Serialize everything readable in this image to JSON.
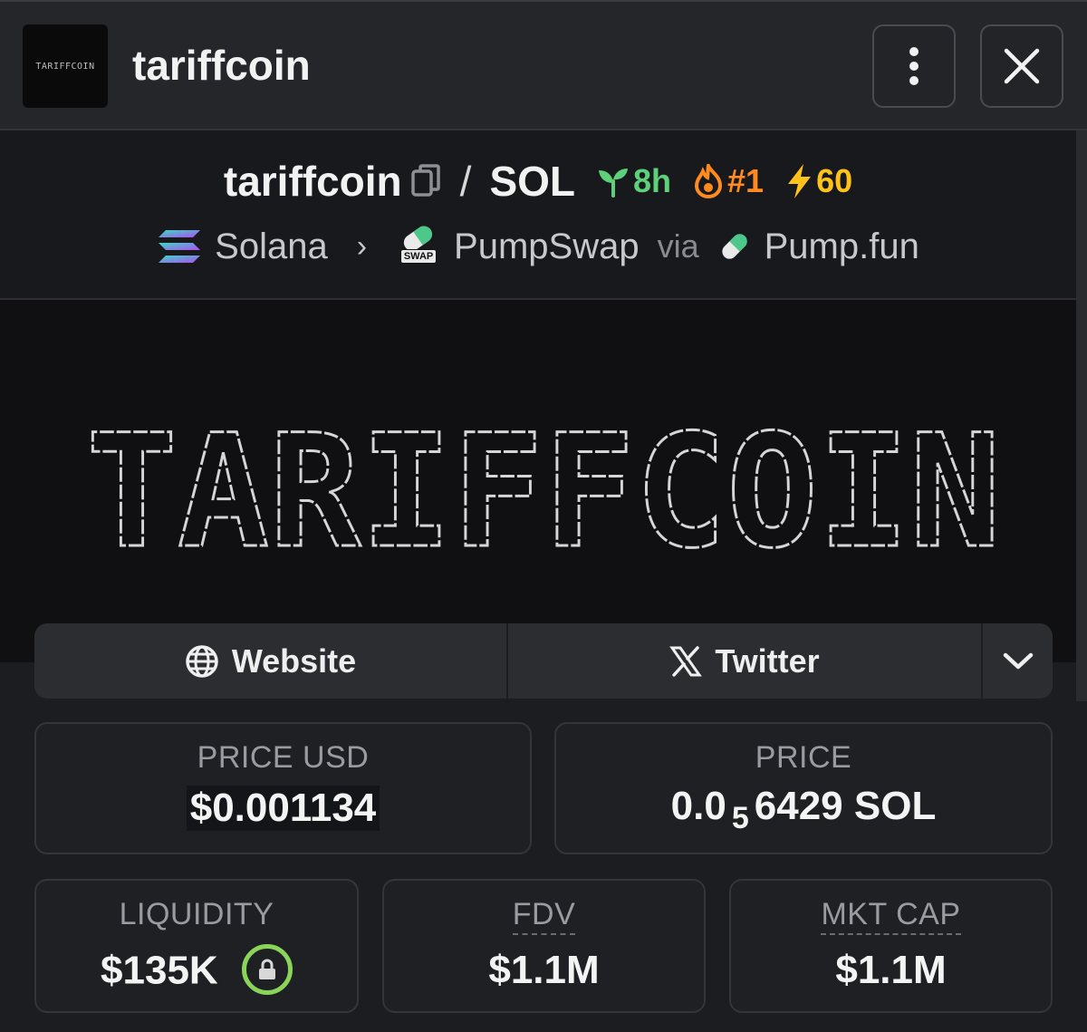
{
  "header": {
    "avatar_text": "TARIFFCOIN",
    "token_name": "tariffcoin",
    "more_icon": "vertical-dots-icon",
    "close_icon": "close-icon"
  },
  "pair": {
    "base": "tariffcoin",
    "separator": "/",
    "quote": "SOL",
    "age": "8h",
    "rank": "#1",
    "boosts": "60",
    "colors": {
      "age": "#5ed07a",
      "rank": "#ff8a1f",
      "boosts": "#ffc21a"
    }
  },
  "chain": {
    "network": "Solana",
    "dex": "PumpSwap",
    "dex_icon_text": "SWAP",
    "via": "via",
    "launchpad": "Pump.fun"
  },
  "banner": {
    "text": "TARIFFCOIN"
  },
  "links": {
    "website": "Website",
    "twitter": "Twitter"
  },
  "stats": {
    "price_usd": {
      "label": "PRICE USD",
      "value": "$0.001134"
    },
    "price_native": {
      "label": "PRICE",
      "prefix": "0.0",
      "subscript": "5",
      "digits": "6429",
      "unit": "SOL"
    },
    "liquidity": {
      "label": "LIQUIDITY",
      "value": "$135K"
    },
    "fdv": {
      "label": "FDV",
      "value": "$1.1M"
    },
    "mkt_cap": {
      "label": "MKT CAP",
      "value": "$1.1M"
    }
  }
}
